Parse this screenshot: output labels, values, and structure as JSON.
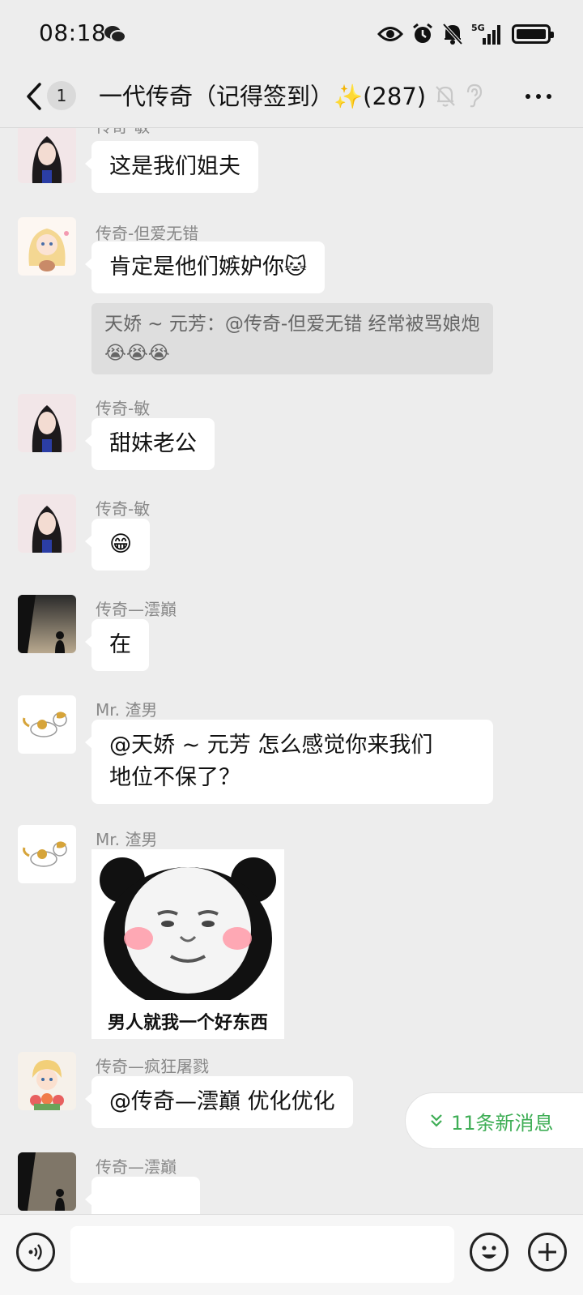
{
  "status_bar": {
    "time": "08:18",
    "network": "5G",
    "icons": [
      "wechat-icon",
      "eye-icon",
      "alarm-icon",
      "bell-off-icon",
      "signal-icon",
      "battery-icon"
    ]
  },
  "header": {
    "unread_count": "1",
    "title": "一代传奇（记得签到）",
    "title_emoji": "✨",
    "member_count": "(287)",
    "icons": [
      "back-chevron-icon",
      "bell-off-icon",
      "ear-icon",
      "more-icon"
    ]
  },
  "messages": [
    {
      "sender": "传奇-敏",
      "text": "这是我们姐夫"
    },
    {
      "sender": "传奇-但爱无错",
      "text": "肯定是他们嫉妒你🐱",
      "quote": "天娇 ~ 元芳：@传奇-但爱无错 经常被骂娘炮😭😭😭"
    },
    {
      "sender": "传奇-敏",
      "text": "甜妹老公"
    },
    {
      "sender": "传奇-敏",
      "text": "😁"
    },
    {
      "sender": "传奇—澐巔",
      "text": "在"
    },
    {
      "sender": "Mr. 渣男",
      "text_line1": "@天娇 ~ 元芳  怎么感觉你来我们",
      "text_line2": "地位不保了？"
    },
    {
      "sender": "Mr. 渣男",
      "sticker_caption": "男人就我一个好东西"
    },
    {
      "sender": "传奇—疯狂屠戮",
      "text": "@传奇—澐巔  优化优化"
    },
    {
      "sender": "传奇—澐巔",
      "text": ""
    }
  ],
  "new_messages_pill": {
    "icon": "double-chevron-down-icon",
    "label": "11条新消息"
  },
  "input_bar": {
    "icons": [
      "voice-icon",
      "emoji-icon",
      "plus-icon"
    ],
    "placeholder": ""
  },
  "colors": {
    "background": "#ededed",
    "bubble": "#ffffff",
    "quote": "#dedede",
    "accent_green": "#3fae56"
  }
}
